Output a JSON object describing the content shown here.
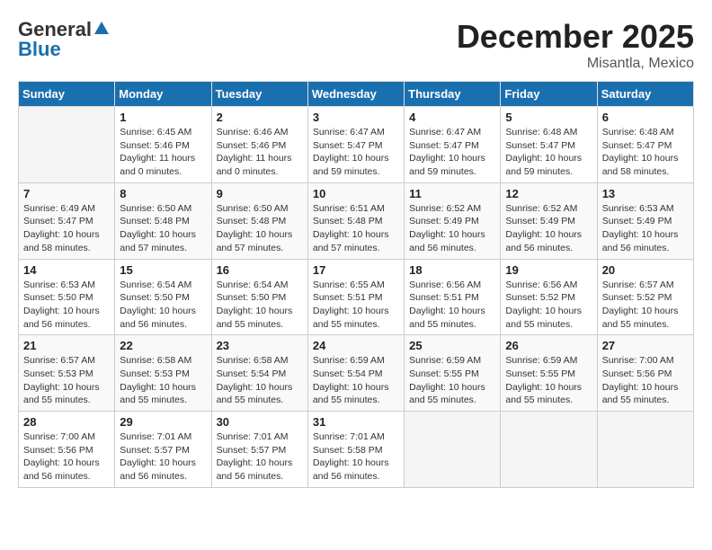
{
  "header": {
    "logo_general": "General",
    "logo_blue": "Blue",
    "month_title": "December 2025",
    "location": "Misantla, Mexico"
  },
  "calendar": {
    "days_of_week": [
      "Sunday",
      "Monday",
      "Tuesday",
      "Wednesday",
      "Thursday",
      "Friday",
      "Saturday"
    ],
    "weeks": [
      [
        {
          "day": "",
          "info": ""
        },
        {
          "day": "1",
          "info": "Sunrise: 6:45 AM\nSunset: 5:46 PM\nDaylight: 11 hours\nand 0 minutes."
        },
        {
          "day": "2",
          "info": "Sunrise: 6:46 AM\nSunset: 5:46 PM\nDaylight: 11 hours\nand 0 minutes."
        },
        {
          "day": "3",
          "info": "Sunrise: 6:47 AM\nSunset: 5:47 PM\nDaylight: 10 hours\nand 59 minutes."
        },
        {
          "day": "4",
          "info": "Sunrise: 6:47 AM\nSunset: 5:47 PM\nDaylight: 10 hours\nand 59 minutes."
        },
        {
          "day": "5",
          "info": "Sunrise: 6:48 AM\nSunset: 5:47 PM\nDaylight: 10 hours\nand 59 minutes."
        },
        {
          "day": "6",
          "info": "Sunrise: 6:48 AM\nSunset: 5:47 PM\nDaylight: 10 hours\nand 58 minutes."
        }
      ],
      [
        {
          "day": "7",
          "info": "Sunrise: 6:49 AM\nSunset: 5:47 PM\nDaylight: 10 hours\nand 58 minutes."
        },
        {
          "day": "8",
          "info": "Sunrise: 6:50 AM\nSunset: 5:48 PM\nDaylight: 10 hours\nand 57 minutes."
        },
        {
          "day": "9",
          "info": "Sunrise: 6:50 AM\nSunset: 5:48 PM\nDaylight: 10 hours\nand 57 minutes."
        },
        {
          "day": "10",
          "info": "Sunrise: 6:51 AM\nSunset: 5:48 PM\nDaylight: 10 hours\nand 57 minutes."
        },
        {
          "day": "11",
          "info": "Sunrise: 6:52 AM\nSunset: 5:49 PM\nDaylight: 10 hours\nand 56 minutes."
        },
        {
          "day": "12",
          "info": "Sunrise: 6:52 AM\nSunset: 5:49 PM\nDaylight: 10 hours\nand 56 minutes."
        },
        {
          "day": "13",
          "info": "Sunrise: 6:53 AM\nSunset: 5:49 PM\nDaylight: 10 hours\nand 56 minutes."
        }
      ],
      [
        {
          "day": "14",
          "info": "Sunrise: 6:53 AM\nSunset: 5:50 PM\nDaylight: 10 hours\nand 56 minutes."
        },
        {
          "day": "15",
          "info": "Sunrise: 6:54 AM\nSunset: 5:50 PM\nDaylight: 10 hours\nand 56 minutes."
        },
        {
          "day": "16",
          "info": "Sunrise: 6:54 AM\nSunset: 5:50 PM\nDaylight: 10 hours\nand 55 minutes."
        },
        {
          "day": "17",
          "info": "Sunrise: 6:55 AM\nSunset: 5:51 PM\nDaylight: 10 hours\nand 55 minutes."
        },
        {
          "day": "18",
          "info": "Sunrise: 6:56 AM\nSunset: 5:51 PM\nDaylight: 10 hours\nand 55 minutes."
        },
        {
          "day": "19",
          "info": "Sunrise: 6:56 AM\nSunset: 5:52 PM\nDaylight: 10 hours\nand 55 minutes."
        },
        {
          "day": "20",
          "info": "Sunrise: 6:57 AM\nSunset: 5:52 PM\nDaylight: 10 hours\nand 55 minutes."
        }
      ],
      [
        {
          "day": "21",
          "info": "Sunrise: 6:57 AM\nSunset: 5:53 PM\nDaylight: 10 hours\nand 55 minutes."
        },
        {
          "day": "22",
          "info": "Sunrise: 6:58 AM\nSunset: 5:53 PM\nDaylight: 10 hours\nand 55 minutes."
        },
        {
          "day": "23",
          "info": "Sunrise: 6:58 AM\nSunset: 5:54 PM\nDaylight: 10 hours\nand 55 minutes."
        },
        {
          "day": "24",
          "info": "Sunrise: 6:59 AM\nSunset: 5:54 PM\nDaylight: 10 hours\nand 55 minutes."
        },
        {
          "day": "25",
          "info": "Sunrise: 6:59 AM\nSunset: 5:55 PM\nDaylight: 10 hours\nand 55 minutes."
        },
        {
          "day": "26",
          "info": "Sunrise: 6:59 AM\nSunset: 5:55 PM\nDaylight: 10 hours\nand 55 minutes."
        },
        {
          "day": "27",
          "info": "Sunrise: 7:00 AM\nSunset: 5:56 PM\nDaylight: 10 hours\nand 55 minutes."
        }
      ],
      [
        {
          "day": "28",
          "info": "Sunrise: 7:00 AM\nSunset: 5:56 PM\nDaylight: 10 hours\nand 56 minutes."
        },
        {
          "day": "29",
          "info": "Sunrise: 7:01 AM\nSunset: 5:57 PM\nDaylight: 10 hours\nand 56 minutes."
        },
        {
          "day": "30",
          "info": "Sunrise: 7:01 AM\nSunset: 5:57 PM\nDaylight: 10 hours\nand 56 minutes."
        },
        {
          "day": "31",
          "info": "Sunrise: 7:01 AM\nSunset: 5:58 PM\nDaylight: 10 hours\nand 56 minutes."
        },
        {
          "day": "",
          "info": ""
        },
        {
          "day": "",
          "info": ""
        },
        {
          "day": "",
          "info": ""
        }
      ]
    ]
  }
}
